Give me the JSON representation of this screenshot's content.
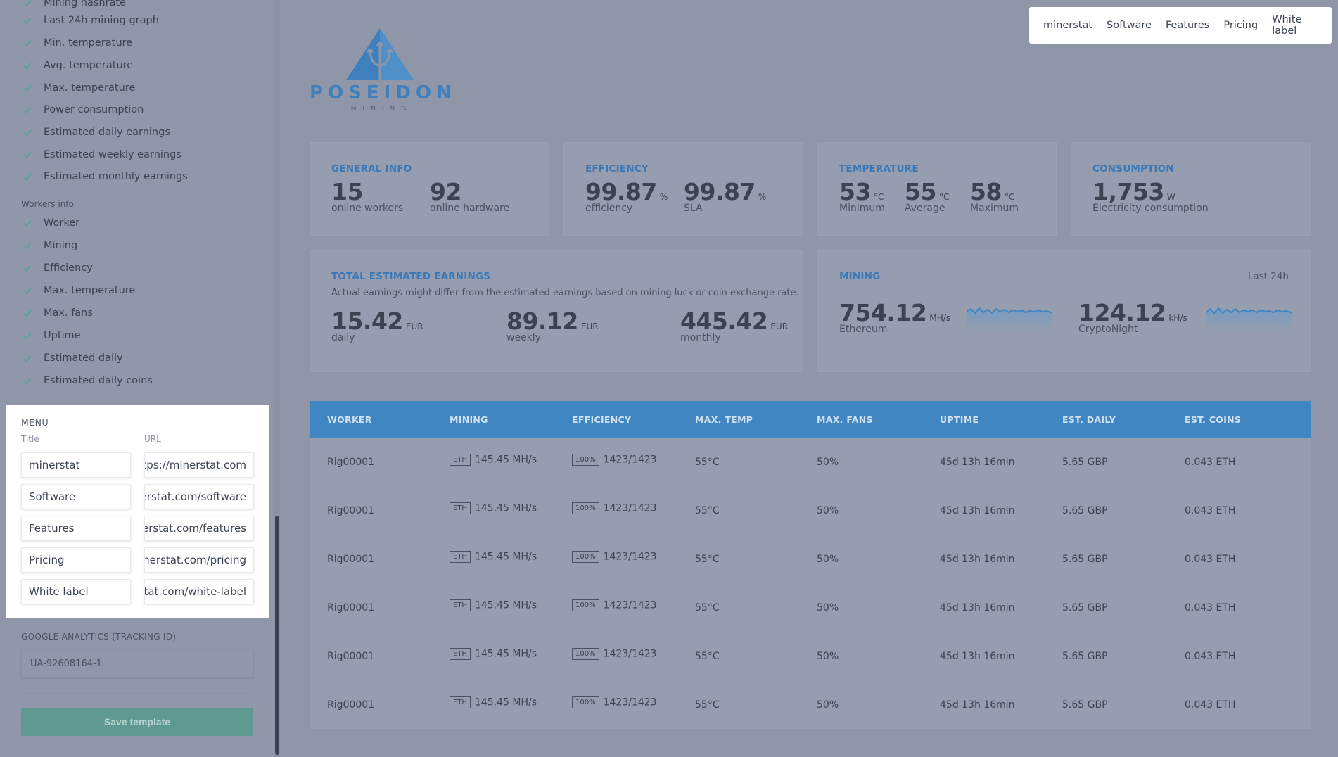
{
  "sidebar": {
    "checked_items_top": [
      "Mining hashrate",
      "Last 24h mining graph",
      "Min. temperature",
      "Avg. temperature",
      "Max. temperature",
      "Power consumption",
      "Estimated daily earnings",
      "Estimated weekly earnings",
      "Estimated monthly earnings"
    ],
    "workers_section_label": "Workers info",
    "checked_items_workers": [
      "Worker",
      "Mining",
      "Efficiency",
      "Max. temperature",
      "Max. fans",
      "Uptime",
      "Estimated daily",
      "Estimated daily coins"
    ],
    "menu_panel": {
      "title": "MENU",
      "title_col": "Title",
      "url_col": "URL",
      "rows": [
        {
          "title": "minerstat",
          "url": "https://minerstat.com"
        },
        {
          "title": "Software",
          "url": "https://minerstat.com/software"
        },
        {
          "title": "Features",
          "url": "https://minerstat.com/features"
        },
        {
          "title": "Pricing",
          "url": "https://minerstat.com/pricing"
        },
        {
          "title": "White label",
          "url": "https://minerstat.com/white-label"
        }
      ]
    },
    "ga_label": "GOOGLE ANALYTICS (TRACKING ID)",
    "ga_value": "UA-92608164-1",
    "save_label": "Save template",
    "colors": {
      "check": "#5aa394",
      "save": "#5f9a90"
    }
  },
  "top_nav": [
    "minerstat",
    "Software",
    "Features",
    "Pricing",
    "White label"
  ],
  "logo": {
    "word": "POSEIDON",
    "sub": "MINING",
    "color": "#3e7fbd"
  },
  "cards": {
    "general": {
      "title": "GENERAL INFO",
      "m1_val": "15",
      "m1_lbl": "online workers",
      "m2_val": "92",
      "m2_lbl": "online hardware"
    },
    "efficiency": {
      "title": "EFFICIENCY",
      "m1_val": "99.87",
      "m1_unit": "%",
      "m1_lbl": "efficiency",
      "m2_val": "99.87",
      "m2_unit": "%",
      "m2_lbl": "SLA"
    },
    "temperature": {
      "title": "TEMPERATURE",
      "m1_val": "53",
      "m1_unit": "°C",
      "m1_lbl": "Minimum",
      "m2_val": "55",
      "m2_unit": "°C",
      "m2_lbl": "Average",
      "m3_val": "58",
      "m3_unit": "°C",
      "m3_lbl": "Maximum"
    },
    "consumption": {
      "title": "CONSUMPTION",
      "m1_val": "1,753",
      "m1_unit": "W",
      "m1_lbl": "Electricity consumption"
    },
    "earnings": {
      "title": "TOTAL ESTIMATED EARNINGS",
      "subtitle": "Actual earnings might differ from the estimated earnings based on mining luck or coin exchange rate.",
      "m1_val": "15.42",
      "m1_unit": "EUR",
      "m1_lbl": "daily",
      "m2_val": "89.12",
      "m2_unit": "EUR",
      "m2_lbl": "weekly",
      "m3_val": "445.42",
      "m3_unit": "EUR",
      "m3_lbl": "monthly"
    },
    "mining": {
      "title": "MINING",
      "right": "Last 24h",
      "m1_val": "754.12",
      "m1_unit": "MH/s",
      "m1_lbl": "Ethereum",
      "m2_val": "124.12",
      "m2_unit": "kH/s",
      "m2_lbl": "CryptoNight"
    }
  },
  "table": {
    "headers": [
      "WORKER",
      "MINING",
      "EFFICIENCY",
      "MAX. TEMP",
      "MAX. FANS",
      "UPTIME",
      "EST. DAILY",
      "EST. COINS"
    ],
    "rows": [
      {
        "worker": "Rig00001",
        "coin": "ETH",
        "hashrate": "145.45 MH/s",
        "eff_badge": "100%",
        "eff": "1423/1423",
        "temp": "55°C",
        "fans": "50%",
        "uptime": "45d 13h 16min",
        "daily": "5.65 GBP",
        "coins": "0.043 ETH"
      },
      {
        "worker": "Rig00001",
        "coin": "ETH",
        "hashrate": "145.45 MH/s",
        "eff_badge": "100%",
        "eff": "1423/1423",
        "temp": "55°C",
        "fans": "50%",
        "uptime": "45d 13h 16min",
        "daily": "5.65 GBP",
        "coins": "0.043 ETH"
      },
      {
        "worker": "Rig00001",
        "coin": "ETH",
        "hashrate": "145.45 MH/s",
        "eff_badge": "100%",
        "eff": "1423/1423",
        "temp": "55°C",
        "fans": "50%",
        "uptime": "45d 13h 16min",
        "daily": "5.65 GBP",
        "coins": "0.043 ETH"
      },
      {
        "worker": "Rig00001",
        "coin": "ETH",
        "hashrate": "145.45 MH/s",
        "eff_badge": "100%",
        "eff": "1423/1423",
        "temp": "55°C",
        "fans": "50%",
        "uptime": "45d 13h 16min",
        "daily": "5.65 GBP",
        "coins": "0.043 ETH"
      },
      {
        "worker": "Rig00001",
        "coin": "ETH",
        "hashrate": "145.45 MH/s",
        "eff_badge": "100%",
        "eff": "1423/1423",
        "temp": "55°C",
        "fans": "50%",
        "uptime": "45d 13h 16min",
        "daily": "5.65 GBP",
        "coins": "0.043 ETH"
      },
      {
        "worker": "Rig00001",
        "coin": "ETH",
        "hashrate": "145.45 MH/s",
        "eff_badge": "100%",
        "eff": "1423/1423",
        "temp": "55°C",
        "fans": "50%",
        "uptime": "45d 13h 16min",
        "daily": "5.65 GBP",
        "coins": "0.043 ETH"
      }
    ]
  },
  "colors": {
    "accent": "#3f86c2",
    "overlay_bg": "#8e96a7",
    "panel_bg": "#ffffff"
  }
}
